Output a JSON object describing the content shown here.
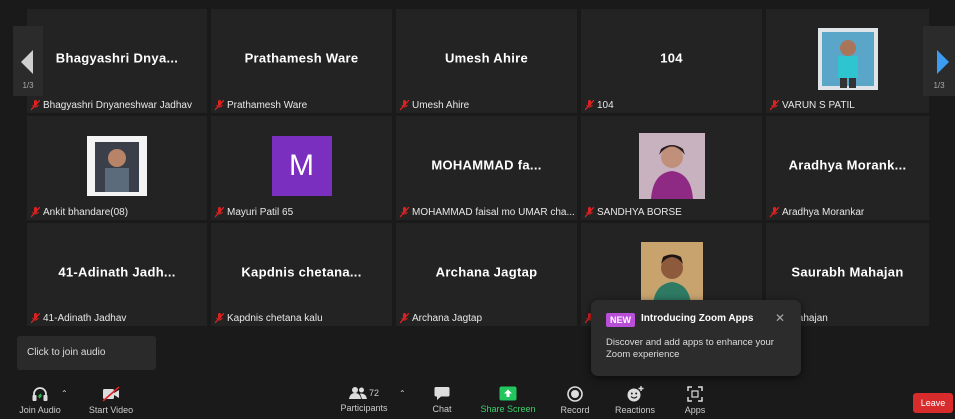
{
  "tiles": [
    {
      "big": "Bhagyashri  Dnya...",
      "label": "Bhagyashri Dnyaneshwar Jadhav"
    },
    {
      "big": "Prathamesh Ware",
      "label": "Prathamesh Ware"
    },
    {
      "big": "Umesh Ahire",
      "label": "Umesh Ahire"
    },
    {
      "big": "104",
      "label": "104"
    },
    {
      "big": "",
      "label": "VARUN S PATIL"
    },
    {
      "big": "",
      "label": "Ankit bhandare(08)"
    },
    {
      "big": "",
      "label": "Mayuri Patil 65",
      "avatar": "M"
    },
    {
      "big": "MOHAMMAD  fa...",
      "label": "MOHAMMAD faisal mo UMAR cha..."
    },
    {
      "big": "",
      "label": "SANDHYA BORSE"
    },
    {
      "big": "Aradhya  Morank...",
      "label": "Aradhya Morankar"
    },
    {
      "big": "41-Adinath  Jadh...",
      "label": "41-Adinath Jadhav"
    },
    {
      "big": "Kapdnis  chetana...",
      "label": "Kapdnis chetana kalu"
    },
    {
      "big": "Archana Jagtap",
      "label": "Archana Jagtap"
    },
    {
      "big": "",
      "label": ""
    },
    {
      "big": "Saurabh Mahajan",
      "label": "abh Mahajan"
    }
  ],
  "nav": {
    "left_page": "1/3",
    "right_page": "1/3"
  },
  "tooltip": "Click to join audio",
  "popup": {
    "badge": "NEW",
    "title": "Introducing Zoom Apps",
    "close": "✕",
    "body": "Discover and add apps to enhance your Zoom experience"
  },
  "toolbar": {
    "join_audio": "Join Audio",
    "start_video": "Start Video",
    "participants": "Participants",
    "participants_count": "72",
    "chat": "Chat",
    "share_screen": "Share Screen",
    "record": "Record",
    "reactions": "Reactions",
    "apps": "Apps",
    "leave": "Leave"
  },
  "colors": {
    "share": "#22c55e",
    "leave": "#d82c2c",
    "new_badge": "#b94fd8",
    "avatar_m": "#7b2fbf"
  }
}
